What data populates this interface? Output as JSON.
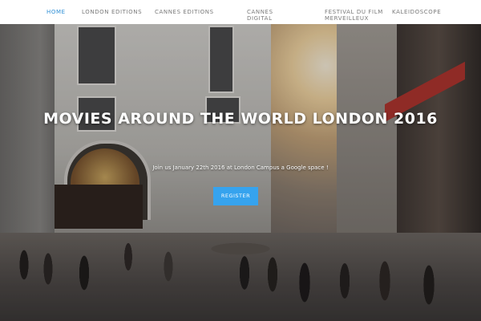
{
  "nav": {
    "items": [
      {
        "label": "HOME",
        "active": true
      },
      {
        "label": "LONDON EDITIONS",
        "has_dropdown": true
      },
      {
        "label": "CANNES EDITIONS",
        "has_dropdown": true
      },
      {
        "label": "CANNES DIGITAL"
      },
      {
        "label": "FESTIVAL DU FILM MERVEILLEUX"
      },
      {
        "label": "KALEIDOSCOPE"
      }
    ]
  },
  "hero": {
    "title": "MOVIES AROUND THE WORLD LONDON 2016",
    "subtitle": "Join us January 22th 2016 at London Campus a Google space !",
    "register_label": "REGISTER"
  },
  "colors": {
    "nav_active": "#2e8fd6",
    "nav_text": "#7a7a7a",
    "button": "#36a3ee"
  }
}
